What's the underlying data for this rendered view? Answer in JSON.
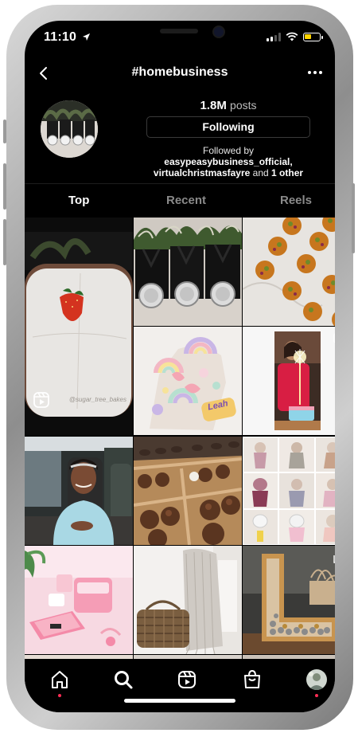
{
  "status_bar": {
    "time": "11:10",
    "signal_bars": 2
  },
  "header": {
    "title": "#homebusiness",
    "back_icon": "chevron-left-icon",
    "more_icon": "more-horizontal-icon"
  },
  "hashtag": {
    "post_count": "1.8M",
    "post_label": "posts",
    "follow_button_label": "Following",
    "followed_by_label": "Followed by",
    "followers": [
      "easypeasybusiness_official",
      "virtualchristmasfayre"
    ],
    "others_suffix": "1 other",
    "and_word": "and"
  },
  "tabs": [
    {
      "label": "Top",
      "active": true
    },
    {
      "label": "Recent",
      "active": false
    },
    {
      "label": "Reels",
      "active": false
    }
  ],
  "grid": {
    "tiles": [
      {
        "name": "grid-post-white-cake-reel",
        "type": "reel",
        "watermark": "@sugar_tree_bakes"
      },
      {
        "name": "grid-post-black-boxes-badges",
        "type": "photo"
      },
      {
        "name": "grid-post-pistachio-cookies",
        "type": "photo"
      },
      {
        "name": "grid-post-rainbow-number-cake",
        "type": "photo",
        "cake_text": "Leah"
      },
      {
        "name": "grid-post-birthday-sparkler",
        "type": "carousel"
      },
      {
        "name": "grid-post-woman-on-train",
        "type": "photo"
      },
      {
        "name": "grid-post-chocolate-trays",
        "type": "photo"
      },
      {
        "name": "grid-post-knitted-dolls",
        "type": "photo"
      },
      {
        "name": "grid-post-pink-label-printer",
        "type": "photo"
      },
      {
        "name": "grid-post-basket-towels",
        "type": "photo"
      },
      {
        "name": "grid-post-letter-l-piggy-bank",
        "type": "carousel"
      }
    ]
  },
  "bottom_nav": [
    {
      "name": "nav-home",
      "icon": "home-icon",
      "dot": true
    },
    {
      "name": "nav-search",
      "icon": "search-icon",
      "dot": false
    },
    {
      "name": "nav-reels",
      "icon": "reels-icon",
      "dot": false
    },
    {
      "name": "nav-shop",
      "icon": "shopping-bag-icon",
      "dot": false
    },
    {
      "name": "nav-profile",
      "icon": "profile-avatar-icon",
      "dot": true
    }
  ],
  "colors": {
    "background": "#000000",
    "text": "#ffffff",
    "muted_tab": "#8a8a8a",
    "notification_dot": "#ff2d55",
    "battery": "#ffd400"
  }
}
